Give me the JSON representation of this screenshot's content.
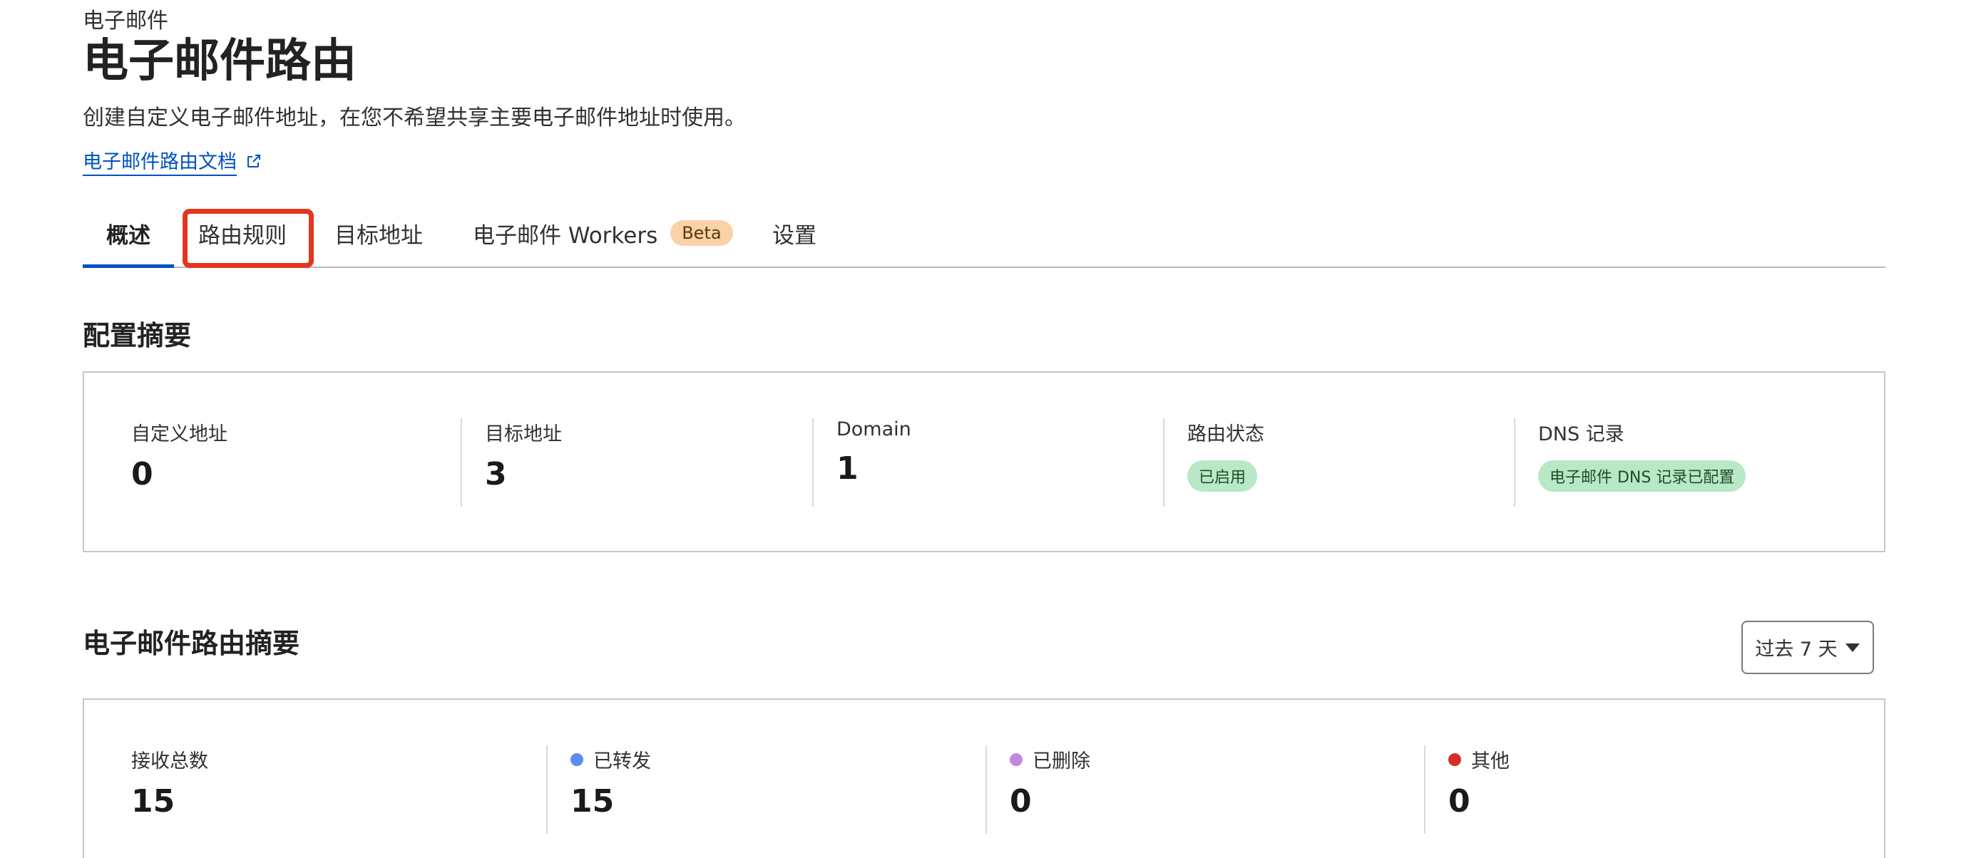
{
  "header": {
    "breadcrumb": "电子邮件",
    "title": "电子邮件路由",
    "description": "创建自定义电子邮件地址，在您不希望共享主要电子邮件地址时使用。",
    "doc_link": "电子邮件路由文档"
  },
  "tabs": [
    {
      "label": "概述",
      "active": true
    },
    {
      "label": "路由规则",
      "active": false,
      "highlighted": true
    },
    {
      "label": "目标地址",
      "active": false
    },
    {
      "label": "电子邮件 Workers",
      "active": false,
      "badge": "Beta"
    },
    {
      "label": "设置",
      "active": false
    }
  ],
  "config_summary": {
    "title": "配置摘要",
    "stats": [
      {
        "label": "自定义地址",
        "value": "0"
      },
      {
        "label": "目标地址",
        "value": "3"
      },
      {
        "label": "Domain",
        "value": "1"
      },
      {
        "label": "路由状态",
        "pill": "已启用"
      },
      {
        "label": "DNS 记录",
        "pill": "电子邮件 DNS 记录已配置"
      }
    ]
  },
  "routing_summary": {
    "title": "电子邮件路由摘要",
    "range": "过去 7 天",
    "stats": [
      {
        "label": "接收总数",
        "value": "15"
      },
      {
        "label": "已转发",
        "value": "15",
        "dot_color": "#5b8def"
      },
      {
        "label": "已删除",
        "value": "0",
        "dot_color": "#c586e0"
      },
      {
        "label": "其他",
        "value": "0",
        "dot_color": "#d22f27"
      }
    ]
  },
  "colors": {
    "accent": "#0051c3",
    "highlight": "#e3361f",
    "success_pill": "#b8e8c6",
    "beta_badge": "#fbd1a8"
  }
}
